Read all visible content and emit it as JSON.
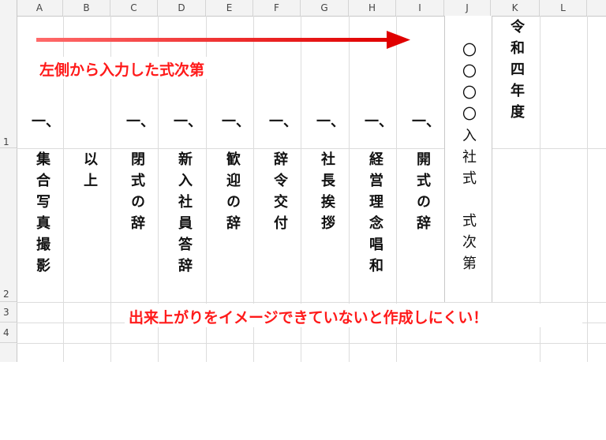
{
  "columns": [
    "A",
    "B",
    "C",
    "D",
    "E",
    "F",
    "G",
    "H",
    "I",
    "J",
    "K",
    "L"
  ],
  "rows": [
    "1",
    "2",
    "3",
    "4"
  ],
  "document": {
    "title": "令和四年度",
    "heading": "〇〇〇〇入社式　式次第",
    "dash": "一、",
    "items": [
      "開式の辞",
      "経営理念唱和",
      "社長挨拶",
      "辞令交付",
      "歓迎の辞",
      "新入社員答辞",
      "閉式の辞",
      "以上",
      "集合写真撮影"
    ]
  },
  "annotations": {
    "top_label": "左側から入力した式次第",
    "bottom_label": "出来上がりをイメージできていないと作成しにくい！"
  },
  "colors": {
    "annotation": "#ff1a1a",
    "arrow": "#e00000"
  }
}
